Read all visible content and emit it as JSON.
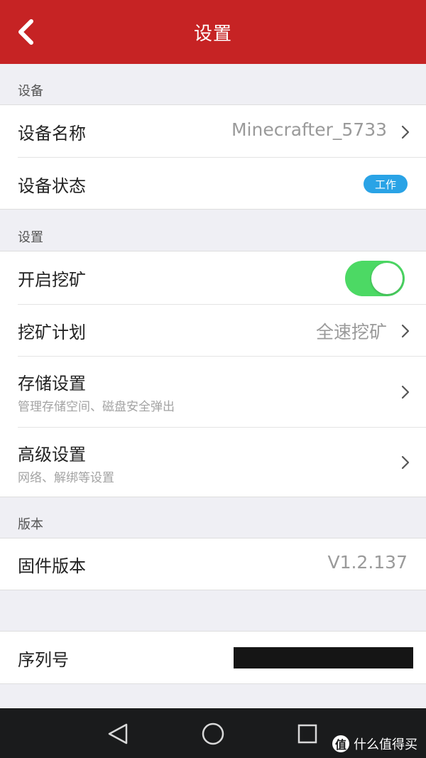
{
  "header": {
    "title": "设置"
  },
  "sections": {
    "device": {
      "label": "设备",
      "name_label": "设备名称",
      "name_value": "Minecrafter_5733",
      "status_label": "设备状态",
      "status_badge": "工作"
    },
    "settings": {
      "label": "设置",
      "mining_label": "开启挖矿",
      "mining_enabled": true,
      "plan_label": "挖矿计划",
      "plan_value": "全速挖矿",
      "storage_label": "存储设置",
      "storage_sub": "管理存储空间、磁盘安全弹出",
      "advanced_label": "高级设置",
      "advanced_sub": "网络、解绑等设置"
    },
    "version": {
      "label": "版本",
      "firmware_label": "固件版本",
      "firmware_value": "V1.2.137"
    },
    "serial": {
      "label": "序列号"
    }
  },
  "watermark": {
    "glyph": "值",
    "text": "什么值得买"
  },
  "colors": {
    "header": "#c62324",
    "toggle_on": "#4cd964",
    "badge": "#2aa3e6",
    "background": "#efeff4"
  },
  "icons": {
    "back": "chevron-left-icon",
    "row_arrow": "chevron-right-icon",
    "nav_back": "triangle-back-icon",
    "nav_home": "circle-home-icon",
    "nav_recent": "square-recent-icon"
  }
}
